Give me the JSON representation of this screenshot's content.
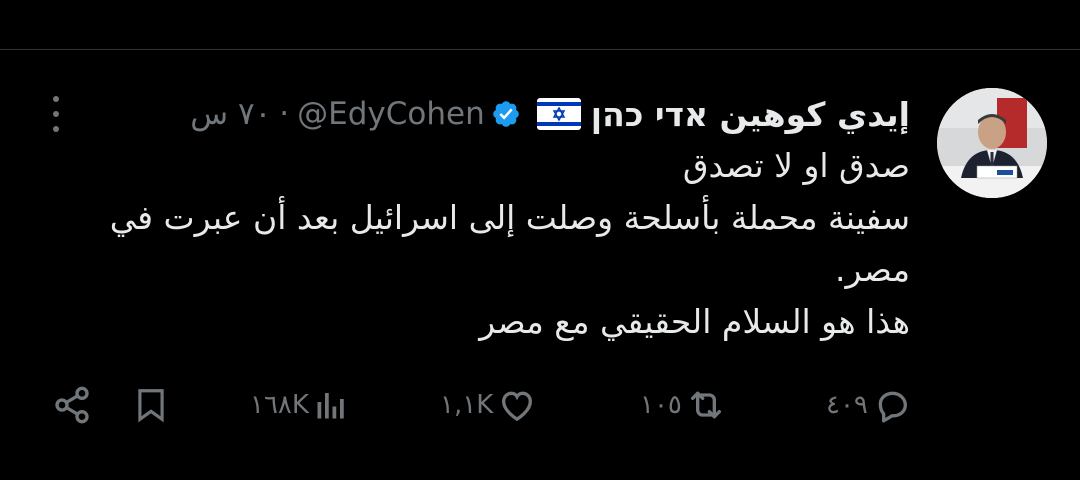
{
  "tweet": {
    "display_name": "إيدي كوهين אדי כהן",
    "flag_icon": "israel-flag-icon",
    "verified_icon": "verified-badge-icon",
    "handle": "@EdyCohen",
    "separator": "·",
    "time": "٧٠ س",
    "lines": [
      "صدق او لا تصدق",
      "سفينة محملة بأسلحة وصلت إلى اسرائيل بعد أن عبرت في مصر.",
      "هذا هو السلام الحقيقي مع مصر"
    ]
  },
  "actions": {
    "replies": "٤٠٩",
    "retweets": "١٠٥",
    "likes": "١,١K",
    "views": "١٦٨K"
  },
  "colors": {
    "background": "#000000",
    "text": "#e7e9ea",
    "muted": "#71767b",
    "verified": "#1d9bf0",
    "flag_blue": "#0038b8"
  }
}
